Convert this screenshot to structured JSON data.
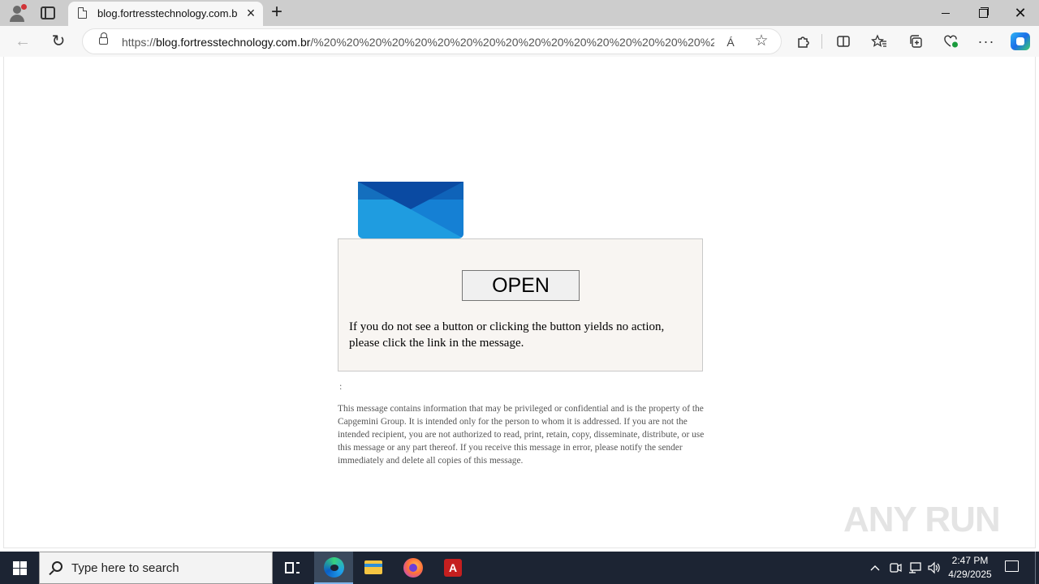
{
  "browser": {
    "tab_title": "blog.fortresstechnology.com.br/",
    "tab_close": "×",
    "new_tab": "+",
    "url_scheme": "https://",
    "url_host": "blog.fortresstechnology.com.br",
    "url_path": "/%20%20%20%20%20%20%20%20%20%20%20%20%20%20%20%20%20%2...",
    "read_aloud": "Á",
    "favorite": "☆",
    "more": "···",
    "window_close": "✕"
  },
  "page": {
    "open_button_label": "OPEN",
    "message_text": "If you do not see a button or clicking the button yields no action, please click the link in the message.",
    "colon": ":",
    "disclaimer": "This message contains information that may be privileged or confidential and is the property of the Capgemini Group. It is intended only for the person to whom it is addressed. If you are not the intended recipient, you are not authorized to read, print, retain, copy, disseminate, distribute, or use this message or any part thereof. If you receive this message in error, please notify the sender immediately and delete all copies of this message.",
    "envelope_colors": {
      "flap_dark": "#0b4aa2",
      "body": "#1f9ce0",
      "fold": "#1580d4"
    },
    "box_background": "#f8f5f2",
    "watermark_text": "ANY RUN"
  },
  "taskbar": {
    "search_placeholder": "Type here to search",
    "time": "2:47 PM",
    "date": "4/29/2025",
    "acrobat_glyph": "A"
  }
}
